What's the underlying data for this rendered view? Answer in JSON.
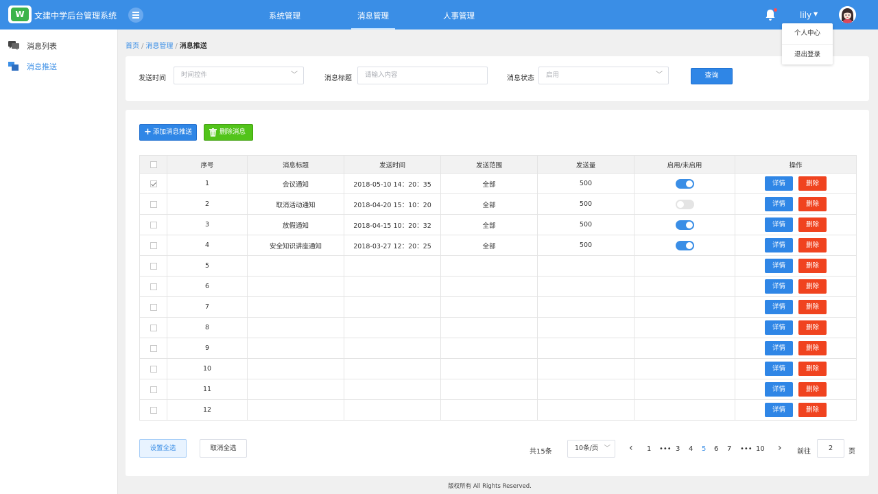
{
  "header": {
    "logo_text": "W",
    "title": "文建中学后台管理系统",
    "nav": [
      {
        "label": "系统管理"
      },
      {
        "label": "消息管理"
      },
      {
        "label": "人事管理"
      }
    ],
    "active_nav": "消息管理",
    "user_name": "lily",
    "accent": "#3a8ee6"
  },
  "user_menu": {
    "items": [
      "个人中心",
      "退出登录"
    ]
  },
  "sidebar": {
    "items": [
      {
        "label": "消息列表",
        "icon": "chat-icon"
      },
      {
        "label": "消息推送",
        "icon": "push-icon"
      }
    ],
    "active": "消息推送"
  },
  "breadcrumb": {
    "items": [
      "首页",
      "消息管理",
      "消息推送"
    ]
  },
  "filters": {
    "time_label": "发送时间",
    "time_placeholder": "时间控件",
    "title_label": "消息标题",
    "title_placeholder": "请输入内容",
    "status_label": "消息状态",
    "status_value": "启用",
    "query_button": "查询"
  },
  "toolbar": {
    "add_label": "添加消息推送",
    "delete_label": "删除消息"
  },
  "table": {
    "headers": [
      "序号",
      "消息标题",
      "发送时间",
      "发送范围",
      "发送量",
      "启用/未启用",
      "操作"
    ],
    "detail_label": "详情",
    "delete_label": "删除",
    "rows": [
      {
        "no": "1",
        "title": "会议通知",
        "time": "2018-05-10  14：20：35",
        "scope": "全部",
        "count": "500",
        "enabled": true,
        "checked": true
      },
      {
        "no": "2",
        "title": "取消活动通知",
        "time": "2018-04-20  15：10：20",
        "scope": "全部",
        "count": "500",
        "enabled": false,
        "checked": false
      },
      {
        "no": "3",
        "title": "放假通知",
        "time": "2018-04-15  10：20：32",
        "scope": "全部",
        "count": "500",
        "enabled": true,
        "checked": false
      },
      {
        "no": "4",
        "title": "安全知识讲座通知",
        "time": "2018-03-27  12：20：25",
        "scope": "全部",
        "count": "500",
        "enabled": true,
        "checked": false
      },
      {
        "no": "5",
        "title": "",
        "time": "",
        "scope": "",
        "count": "",
        "enabled": null,
        "checked": false
      },
      {
        "no": "6",
        "title": "",
        "time": "",
        "scope": "",
        "count": "",
        "enabled": null,
        "checked": false
      },
      {
        "no": "7",
        "title": "",
        "time": "",
        "scope": "",
        "count": "",
        "enabled": null,
        "checked": false
      },
      {
        "no": "8",
        "title": "",
        "time": "",
        "scope": "",
        "count": "",
        "enabled": null,
        "checked": false
      },
      {
        "no": "9",
        "title": "",
        "time": "",
        "scope": "",
        "count": "",
        "enabled": null,
        "checked": false
      },
      {
        "no": "10",
        "title": "",
        "time": "",
        "scope": "",
        "count": "",
        "enabled": null,
        "checked": false
      },
      {
        "no": "11",
        "title": "",
        "time": "",
        "scope": "",
        "count": "",
        "enabled": null,
        "checked": false
      },
      {
        "no": "12",
        "title": "",
        "time": "",
        "scope": "",
        "count": "",
        "enabled": null,
        "checked": false
      }
    ]
  },
  "footer_actions": {
    "select_all": "设置全选",
    "cancel_select": "取消全选"
  },
  "pagination": {
    "total": "共15条",
    "page_size": "10条/页",
    "prev": "‹",
    "next": "›",
    "pages": [
      "1",
      "•••",
      "3",
      "4",
      "5",
      "6",
      "7",
      "•••",
      "10"
    ],
    "current": "5",
    "goto_label": "前往",
    "goto_value": "2",
    "goto_unit": "页"
  },
  "copyright": "版权所有  All Rights Reserved."
}
